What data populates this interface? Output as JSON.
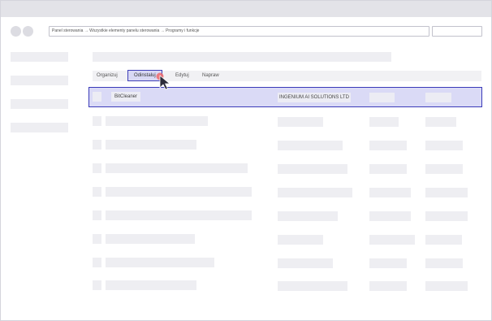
{
  "address_bar": {
    "path": "Panel sterowania → Wszystkie elementy panelu sterowania → Programy i funkcje"
  },
  "toolbar": {
    "organize_label": "Organizuj",
    "uninstall_label": "Odinstaluj",
    "edit_label": "Edytuj",
    "repair_label": "Napraw"
  },
  "programs": {
    "selected_row": {
      "name": "BitCleaner",
      "publisher": "INGENIUM AI SOLUTIONS LTD"
    }
  },
  "colors": {
    "selection_fill": "#dadaf6",
    "selection_border": "#3a3ab8",
    "placeholder": "#eeeef2",
    "cursor_click": "#f06a6a"
  },
  "icons": {
    "cursor": "mouse-pointer-icon",
    "click_indicator": "click-indicator-icon"
  }
}
